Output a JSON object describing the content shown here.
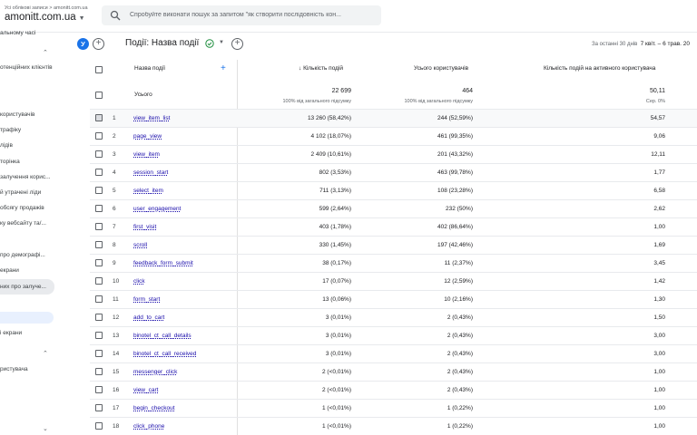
{
  "header": {
    "breadcrumb": "Усі облікові записи > amonitt.com.ua",
    "account": "amonitt.com.ua",
    "search_placeholder": "Спробуйте виконати пошук за запитом \"як створити послідовність кон..."
  },
  "sidebar": {
    "items": [
      "альному часі",
      "отенційних клієнтів",
      "користувачів",
      "трафіку",
      "лідів",
      "торінка",
      "залучення корис...",
      "й утрачені ліди",
      "обсягу продажів",
      "ку вебсайту та/...",
      "про демографі...",
      "екрани",
      "них про залуче...",
      "і екрани",
      "ристувача"
    ]
  },
  "report": {
    "avatar_letter": "У",
    "title": "Події: Назва події",
    "date_label": "За останні 30 днів",
    "date_range": "7 квіт. – 6 трав. 20"
  },
  "table": {
    "headers": {
      "event_name": "Назва події",
      "event_count": "Кількість подій",
      "total_users": "Усього користувачів",
      "per_active_user": "Кількість подій на активного користувача"
    },
    "totals": {
      "label": "Усього",
      "event_count": "22 699",
      "event_count_sub": "100% від загального підсумку",
      "total_users": "464",
      "total_users_sub": "100% від загального підсумку",
      "per_active_user": "50,11",
      "per_active_user_sub": "Сер. 0%"
    },
    "rows": [
      {
        "idx": "1",
        "name": "view_item_list",
        "count": "13 260 (58,42%)",
        "users": "244 (52,59%)",
        "per_user": "54,57"
      },
      {
        "idx": "2",
        "name": "page_view",
        "count": "4 102 (18,07%)",
        "users": "461 (99,35%)",
        "per_user": "9,06"
      },
      {
        "idx": "3",
        "name": "view_item",
        "count": "2 409 (10,61%)",
        "users": "201 (43,32%)",
        "per_user": "12,11"
      },
      {
        "idx": "4",
        "name": "session_start",
        "count": "802 (3,53%)",
        "users": "463 (99,78%)",
        "per_user": "1,77"
      },
      {
        "idx": "5",
        "name": "select_item",
        "count": "711 (3,13%)",
        "users": "108 (23,28%)",
        "per_user": "6,58"
      },
      {
        "idx": "6",
        "name": "user_engagement",
        "count": "599 (2,64%)",
        "users": "232 (50%)",
        "per_user": "2,62"
      },
      {
        "idx": "7",
        "name": "first_visit",
        "count": "403 (1,78%)",
        "users": "402 (86,64%)",
        "per_user": "1,00"
      },
      {
        "idx": "8",
        "name": "scroll",
        "count": "330 (1,45%)",
        "users": "197 (42,46%)",
        "per_user": "1,69"
      },
      {
        "idx": "9",
        "name": "feedback_form_submit",
        "count": "38 (0,17%)",
        "users": "11 (2,37%)",
        "per_user": "3,45"
      },
      {
        "idx": "10",
        "name": "click",
        "count": "17 (0,07%)",
        "users": "12 (2,59%)",
        "per_user": "1,42"
      },
      {
        "idx": "11",
        "name": "form_start",
        "count": "13 (0,06%)",
        "users": "10 (2,16%)",
        "per_user": "1,30"
      },
      {
        "idx": "12",
        "name": "add_to_cart",
        "count": "3 (0,01%)",
        "users": "2 (0,43%)",
        "per_user": "1,50"
      },
      {
        "idx": "13",
        "name": "binotel_ct_call_details",
        "count": "3 (0,01%)",
        "users": "2 (0,43%)",
        "per_user": "3,00"
      },
      {
        "idx": "14",
        "name": "binotel_ct_call_received",
        "count": "3 (0,01%)",
        "users": "2 (0,43%)",
        "per_user": "3,00"
      },
      {
        "idx": "15",
        "name": "messenger_click",
        "count": "2 (<0,01%)",
        "users": "2 (0,43%)",
        "per_user": "1,00"
      },
      {
        "idx": "16",
        "name": "view_cart",
        "count": "2 (<0,01%)",
        "users": "2 (0,43%)",
        "per_user": "1,00"
      },
      {
        "idx": "17",
        "name": "begin_checkout",
        "count": "1 (<0,01%)",
        "users": "1 (0,22%)",
        "per_user": "1,00"
      },
      {
        "idx": "18",
        "name": "click_phone",
        "count": "1 (<0,01%)",
        "users": "1 (0,22%)",
        "per_user": "1,00"
      }
    ]
  }
}
